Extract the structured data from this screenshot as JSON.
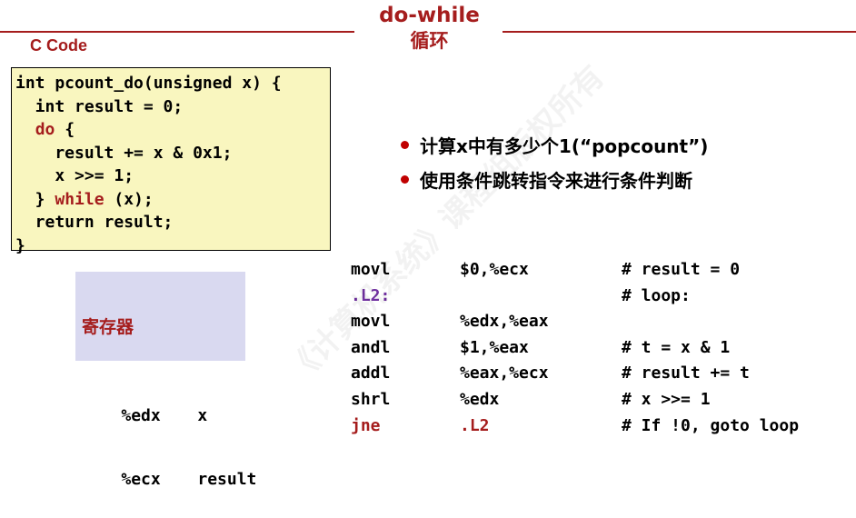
{
  "title": {
    "line1": "do-while",
    "line2": "循环"
  },
  "c_code": {
    "label": "C Code",
    "lines": [
      [
        {
          "t": "int pcount_do(unsigned x) {"
        }
      ],
      [
        {
          "t": "  int result = 0;"
        }
      ],
      [
        {
          "t": "  "
        },
        {
          "t": "do",
          "k": true
        },
        {
          "t": " {"
        }
      ],
      [
        {
          "t": "    result += x & 0x1;"
        }
      ],
      [
        {
          "t": "    x >>= 1;"
        }
      ],
      [
        {
          "t": "  } "
        },
        {
          "t": "while",
          "k": true
        },
        {
          "t": " (x);"
        }
      ],
      [
        {
          "t": "  return result;"
        }
      ],
      [
        {
          "t": "}"
        }
      ]
    ]
  },
  "registers": {
    "title": "寄存器",
    "rows": [
      {
        "reg": "%edx",
        "use": "x"
      },
      {
        "reg": "%ecx",
        "use": "result"
      }
    ]
  },
  "bullets": [
    "计算x中有多少个1(“popcount”)",
    "使用条件跳转指令来进行条件判断"
  ],
  "assembly": [
    {
      "op": "movl",
      "arg": "$0,%ecx",
      "comment": "# result = 0",
      "style": ""
    },
    {
      "op": ".L2:",
      "arg": "",
      "comment": "# loop:",
      "style": "label"
    },
    {
      "op": "movl",
      "arg": "%edx,%eax",
      "comment": "",
      "style": ""
    },
    {
      "op": "andl",
      "arg": "$1,%eax",
      "comment": "# t = x & 1",
      "style": ""
    },
    {
      "op": "addl",
      "arg": "%eax,%ecx",
      "comment": "# result += t",
      "style": ""
    },
    {
      "op": "shrl",
      "arg": "%edx",
      "comment": "# x >>= 1",
      "style": ""
    },
    {
      "op": "jne",
      "arg": ".L2",
      "comment": "# If !0, goto loop",
      "style": "jump"
    }
  ],
  "watermark": "《计算机系统》课程组版权所有"
}
